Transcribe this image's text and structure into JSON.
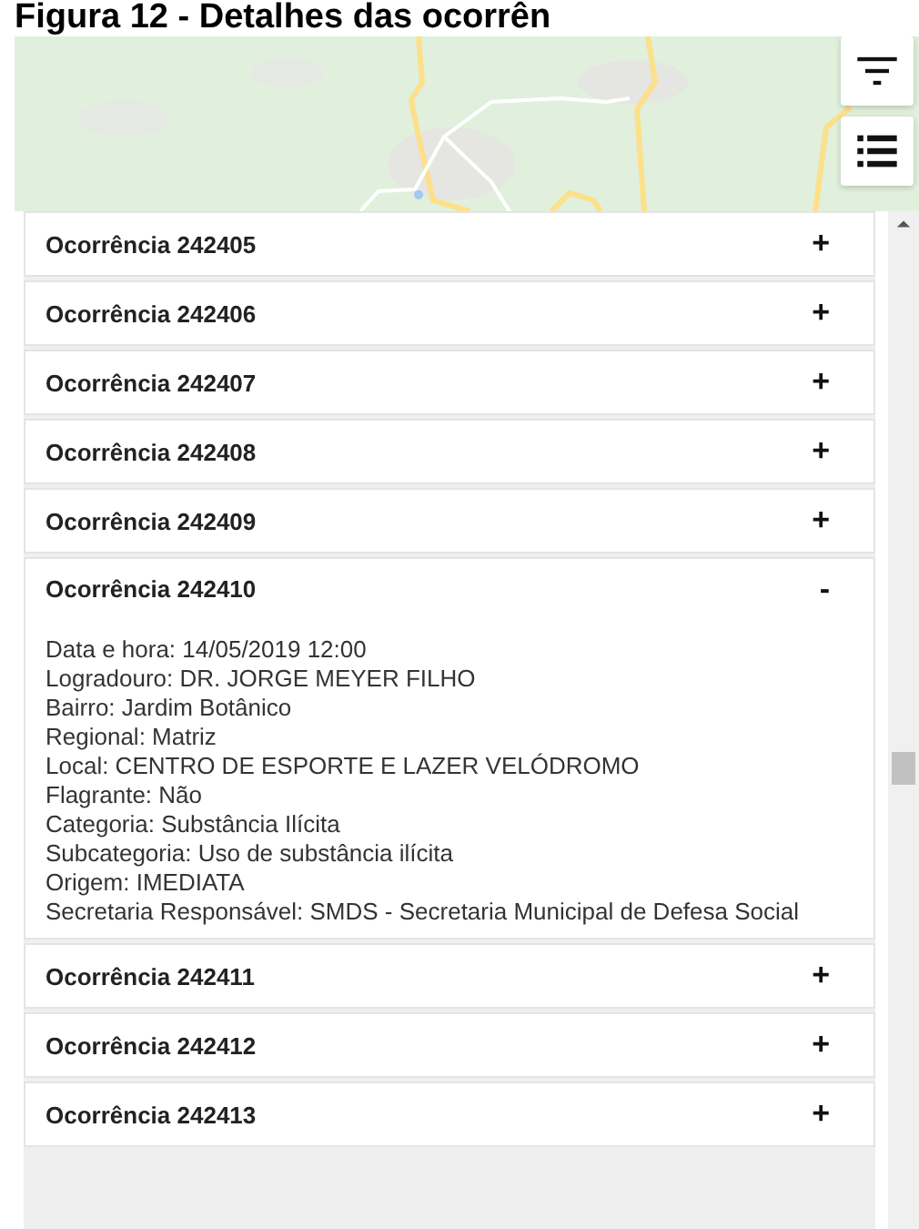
{
  "caption": "Figura 12 - Detalhes das ocorrên",
  "map_buttons": [
    {
      "kind": "filter"
    },
    {
      "kind": "list"
    }
  ],
  "occurrences": [
    {
      "title": "Ocorrência 242405",
      "toggle": "+",
      "expanded": false
    },
    {
      "title": "Ocorrência 242406",
      "toggle": "+",
      "expanded": false
    },
    {
      "title": "Ocorrência 242407",
      "toggle": "+",
      "expanded": false
    },
    {
      "title": "Ocorrência 242408",
      "toggle": "+",
      "expanded": false
    },
    {
      "title": "Ocorrência 242409",
      "toggle": "+",
      "expanded": false
    },
    {
      "title": "Ocorrência 242410",
      "toggle": "-",
      "expanded": true,
      "details": [
        "Data e hora: 14/05/2019 12:00",
        "Logradouro: DR. JORGE MEYER FILHO",
        "Bairro: Jardim Botânico",
        "Regional: Matriz",
        "Local: CENTRO DE ESPORTE E LAZER VELÓDROMO",
        "Flagrante: Não",
        "Categoria: Substância Ilícita",
        "Subcategoria: Uso de substância ilícita",
        "Origem: IMEDIATA",
        "Secretaria Responsável: SMDS - Secretaria Municipal de Defesa Social"
      ]
    },
    {
      "title": "Ocorrência 242411",
      "toggle": "+",
      "expanded": false
    },
    {
      "title": "Ocorrência 242412",
      "toggle": "+",
      "expanded": false
    },
    {
      "title": "Ocorrência 242413",
      "toggle": "+",
      "expanded": false
    }
  ]
}
